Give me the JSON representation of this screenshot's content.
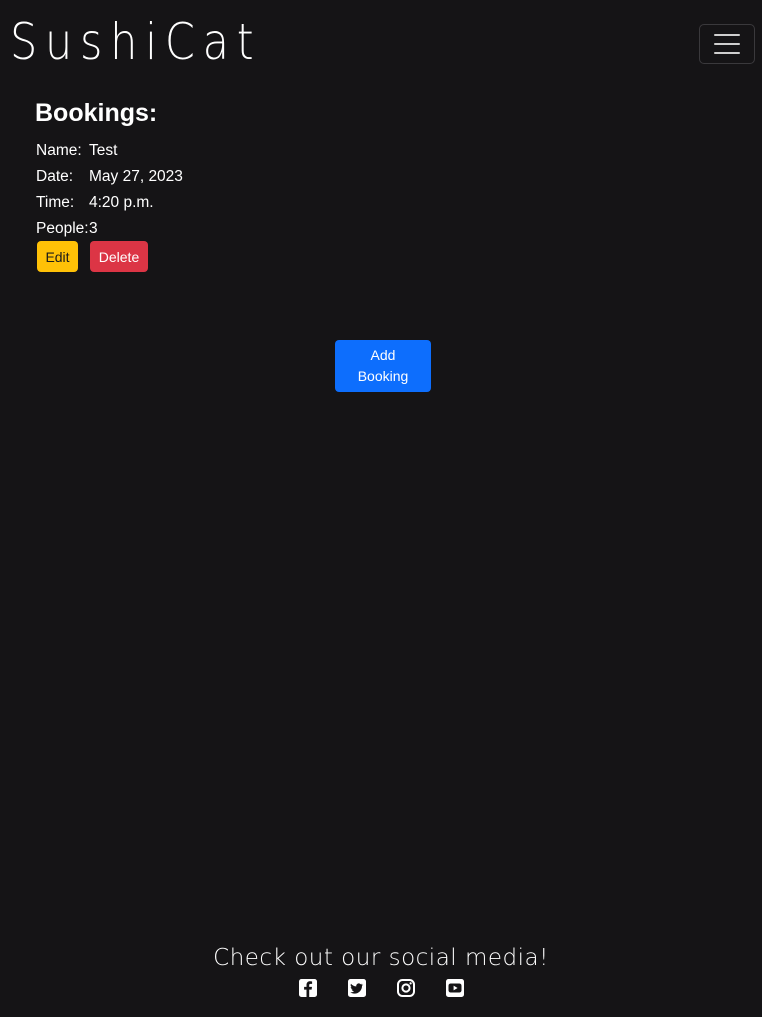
{
  "navbar": {
    "brand": "SushiCat",
    "toggler_icon": "hamburger-menu-icon"
  },
  "bookings": {
    "heading": "Bookings:",
    "rows": [
      {
        "label": "Name:",
        "value": "Test"
      },
      {
        "label": "Date:",
        "value": "May 27, 2023"
      },
      {
        "label": "Time:",
        "value": "4:20 p.m."
      },
      {
        "label": "People:",
        "value": "3"
      }
    ],
    "edit_label": "Edit",
    "delete_label": "Delete",
    "add_label": "Add Booking"
  },
  "footer": {
    "text": "Check out our social media!",
    "social_icons": [
      "facebook-icon",
      "twitter-icon",
      "instagram-icon",
      "youtube-icon"
    ]
  },
  "colors": {
    "background": "#151416",
    "edit": "#ffc107",
    "delete": "#dc3545",
    "add": "#0d6efd"
  }
}
